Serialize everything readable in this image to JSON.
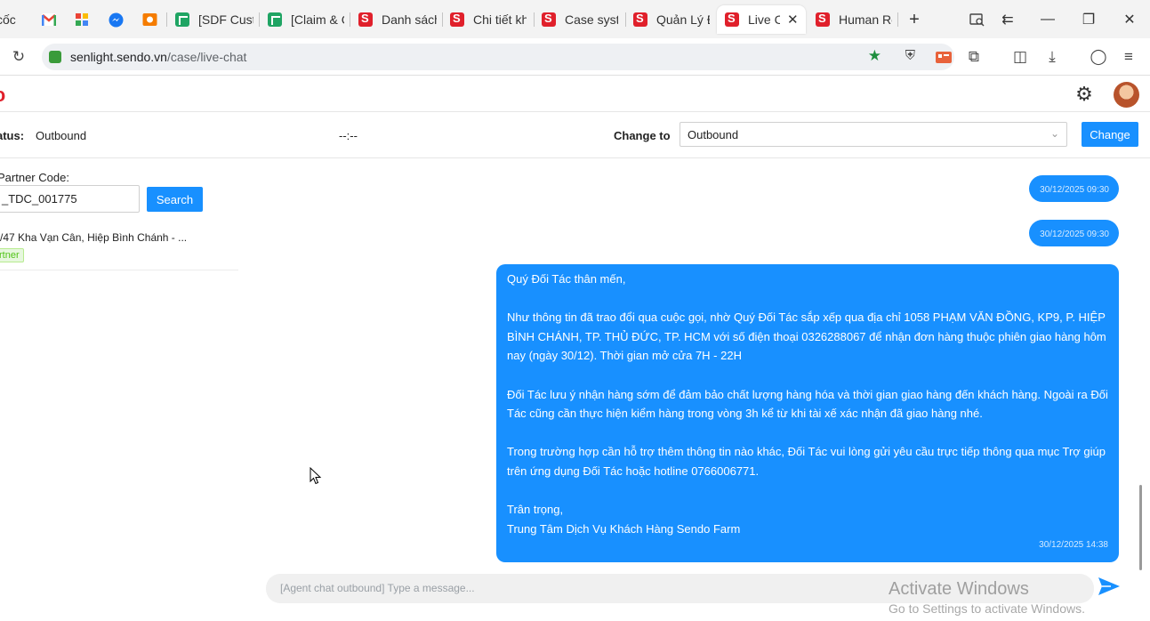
{
  "browser": {
    "tabs": [
      {
        "label": "cốc",
        "icon": "bookmark-icon"
      },
      {
        "label": "",
        "icon": "gmail-icon"
      },
      {
        "label": "",
        "icon": "app-icon"
      },
      {
        "label": "",
        "icon": "messenger-icon"
      },
      {
        "label": "",
        "icon": "photo-icon"
      },
      {
        "label": "[SDF Custo",
        "icon": "sheets-icon"
      },
      {
        "label": "[Claim & C",
        "icon": "sheets-icon"
      },
      {
        "label": "Danh sách",
        "icon": "sendo-icon"
      },
      {
        "label": "Chi tiết kh",
        "icon": "sendo-icon"
      },
      {
        "label": "Case syste",
        "icon": "sendo-icon"
      },
      {
        "label": "Quản Lý Đ",
        "icon": "sendo-icon"
      },
      {
        "label": "Live C",
        "icon": "sendo-icon",
        "active": true
      },
      {
        "label": "Human Re",
        "icon": "sendo-icon"
      }
    ],
    "url_host": "senlight.sendo.vn",
    "url_path": "/case/live-chat"
  },
  "status": {
    "label": "atus:",
    "value": "Outbound",
    "timer": "--:--",
    "change_to_label": "Change to",
    "change_to_value": "Outbound",
    "change_button": "Change"
  },
  "partner": {
    "code_label": "Partner Code:",
    "code_value": "_TDC_001775",
    "search_button": "Search",
    "address": "/47 Kha Vạn Cân, Hiệp Bình Chánh - ...",
    "tag": "rtner"
  },
  "chat": {
    "messages": [
      {
        "timestamp": "30/12/2025 09:30"
      },
      {
        "timestamp": "30/12/2025 09:30"
      },
      {
        "greeting": "Quý Đối Tác thân mến,",
        "para1": "Như thông tin đã trao đổi qua cuộc gọi, nhờ Quý Đối Tác sắp xếp qua địa chỉ 1058 PHẠM VĂN ĐỒNG, KP9, P. HIỆP BÌNH CHÁNH, TP. THỦ ĐỨC, TP. HCM với số điện thoại 0326288067 để nhận đơn hàng thuộc phiên giao hàng hôm nay (ngày 30/12). Thời gian mở cửa 7H - 22H",
        "para2": "Đối Tác lưu ý nhận hàng sớm để đảm bảo chất lượng hàng hóa và thời gian giao hàng đến khách hàng. Ngoài ra Đối Tác cũng cần thực hiện kiểm hàng trong vòng 3h kể từ khi tài xế xác nhận đã giao hàng nhé.",
        "para3": "Trong trường hợp cần hỗ trợ thêm thông tin nào khác, Đối Tác vui lòng gửi yêu cầu trực tiếp thông qua mục Trợ giúp trên ứng dụng Đối Tác hoặc hotline 0766006771.",
        "closing": "Trân trọng,",
        "signature": "Trung Tâm Dịch Vụ Khách Hàng Sendo Farm",
        "timestamp": "30/12/2025 14:38"
      }
    ],
    "input_placeholder": "[Agent chat outbound] Type a message..."
  },
  "watermark": {
    "line1": "Activate Windows",
    "line2": "Go to Settings to activate Windows."
  },
  "colors": {
    "primary": "#1890ff",
    "brand": "#e0202b",
    "tag_green": "#52c41a"
  }
}
